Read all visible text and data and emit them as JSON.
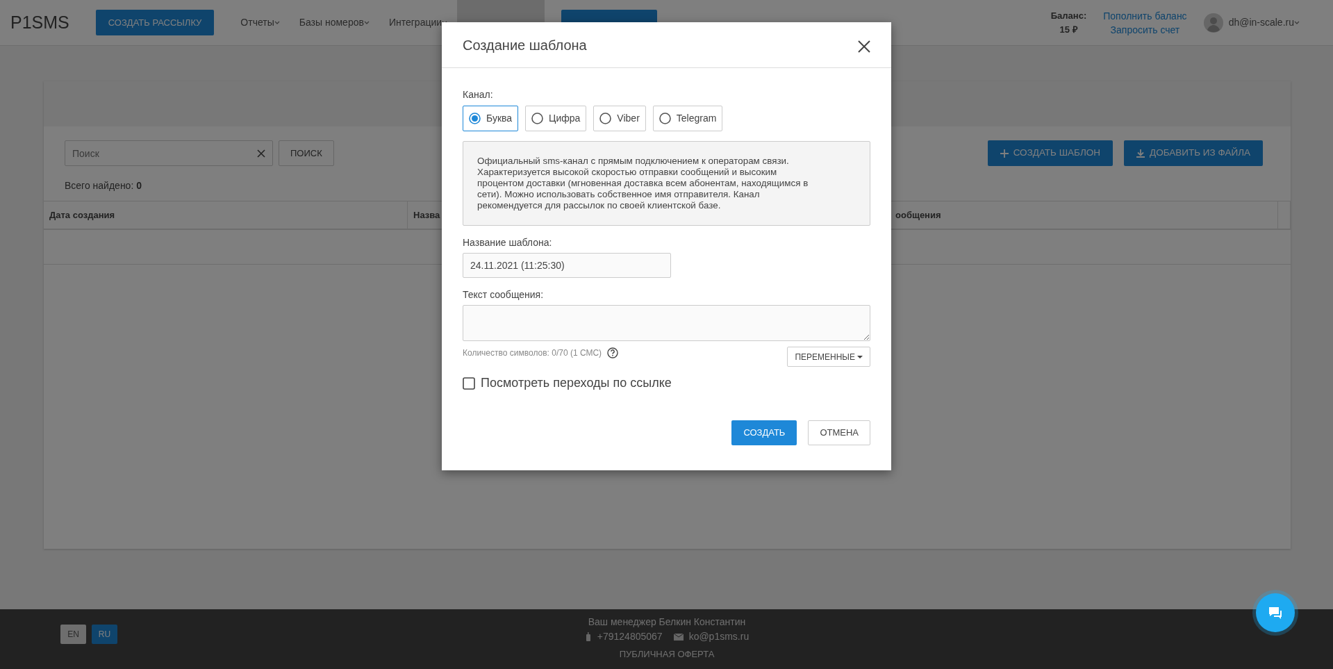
{
  "navbar": {
    "logo": "P1SMS",
    "primary_button": "СОЗДАТЬ РАССЫЛКУ",
    "menu": [
      {
        "label": "Отчеты",
        "selected": false
      },
      {
        "label": "Базы номеров",
        "selected": false
      },
      {
        "label": "Интеграции",
        "selected": false
      },
      {
        "selected": true
      }
    ],
    "balance_label": "Баланс:",
    "balance_amount": "15 ₽",
    "balance_links": [
      "Пополнить баланс",
      "Запросить счет"
    ],
    "user": "dh@in-scale.ru"
  },
  "page": {
    "search": {
      "placeholder": "Поиск"
    },
    "search_button": "ПОИСК",
    "actions": [
      {
        "kind": "add",
        "label": "СОЗДАТЬ ШАБЛОН"
      },
      {
        "kind": "download",
        "label": "ДОБАВИТЬ ИЗ ФАЙЛА"
      }
    ],
    "total_label": "Всего найдено:",
    "total_value": "0",
    "table": {
      "columns": [
        "Дата создания",
        "Назва",
        "ообщения"
      ]
    }
  },
  "modal": {
    "title": "Создание шаблона",
    "channel_label": "Канал:",
    "channels": [
      {
        "label": "Буква",
        "selected": true
      },
      {
        "label": "Цифра",
        "selected": false
      },
      {
        "label": "Viber",
        "selected": false
      },
      {
        "label": "Telegram",
        "selected": false
      }
    ],
    "description": "Официальный sms-канал с прямым подключением к операторам связи. Характеризуется высокой скоростью отправки сообщений и высоким процентом доставки (мгновенная доставка всем абонентам, находящимся в сети). Можно использовать собственное имя отправителя. Канал рекомендуется для рассылок по своей клиентской базе.",
    "name_label": "Название шаблона:",
    "name_value": "24.11.2021 (11:25:30)",
    "text_label": "Текст сообщения:",
    "counter": "Количество символов: 0/70 (1 СМС)",
    "variables_button": "ПЕРЕМЕННЫЕ",
    "track_clicks": {
      "label": "Посмотреть переходы по ссылке",
      "checked": false
    },
    "buttons": [
      {
        "kind": "primary",
        "label": "СОЗДАТЬ"
      },
      {
        "kind": "secondary",
        "label": "ОТМЕНА"
      }
    ]
  },
  "footer": {
    "languages": [
      {
        "label": "EN",
        "selected": false
      },
      {
        "label": "RU",
        "selected": true
      }
    ],
    "manager": "Ваш менеджер Белкин Константин",
    "phone": "+79124805067",
    "email": "ko@p1sms.ru",
    "offer": "ПУБЛИЧНАЯ ОФЕРТА"
  }
}
